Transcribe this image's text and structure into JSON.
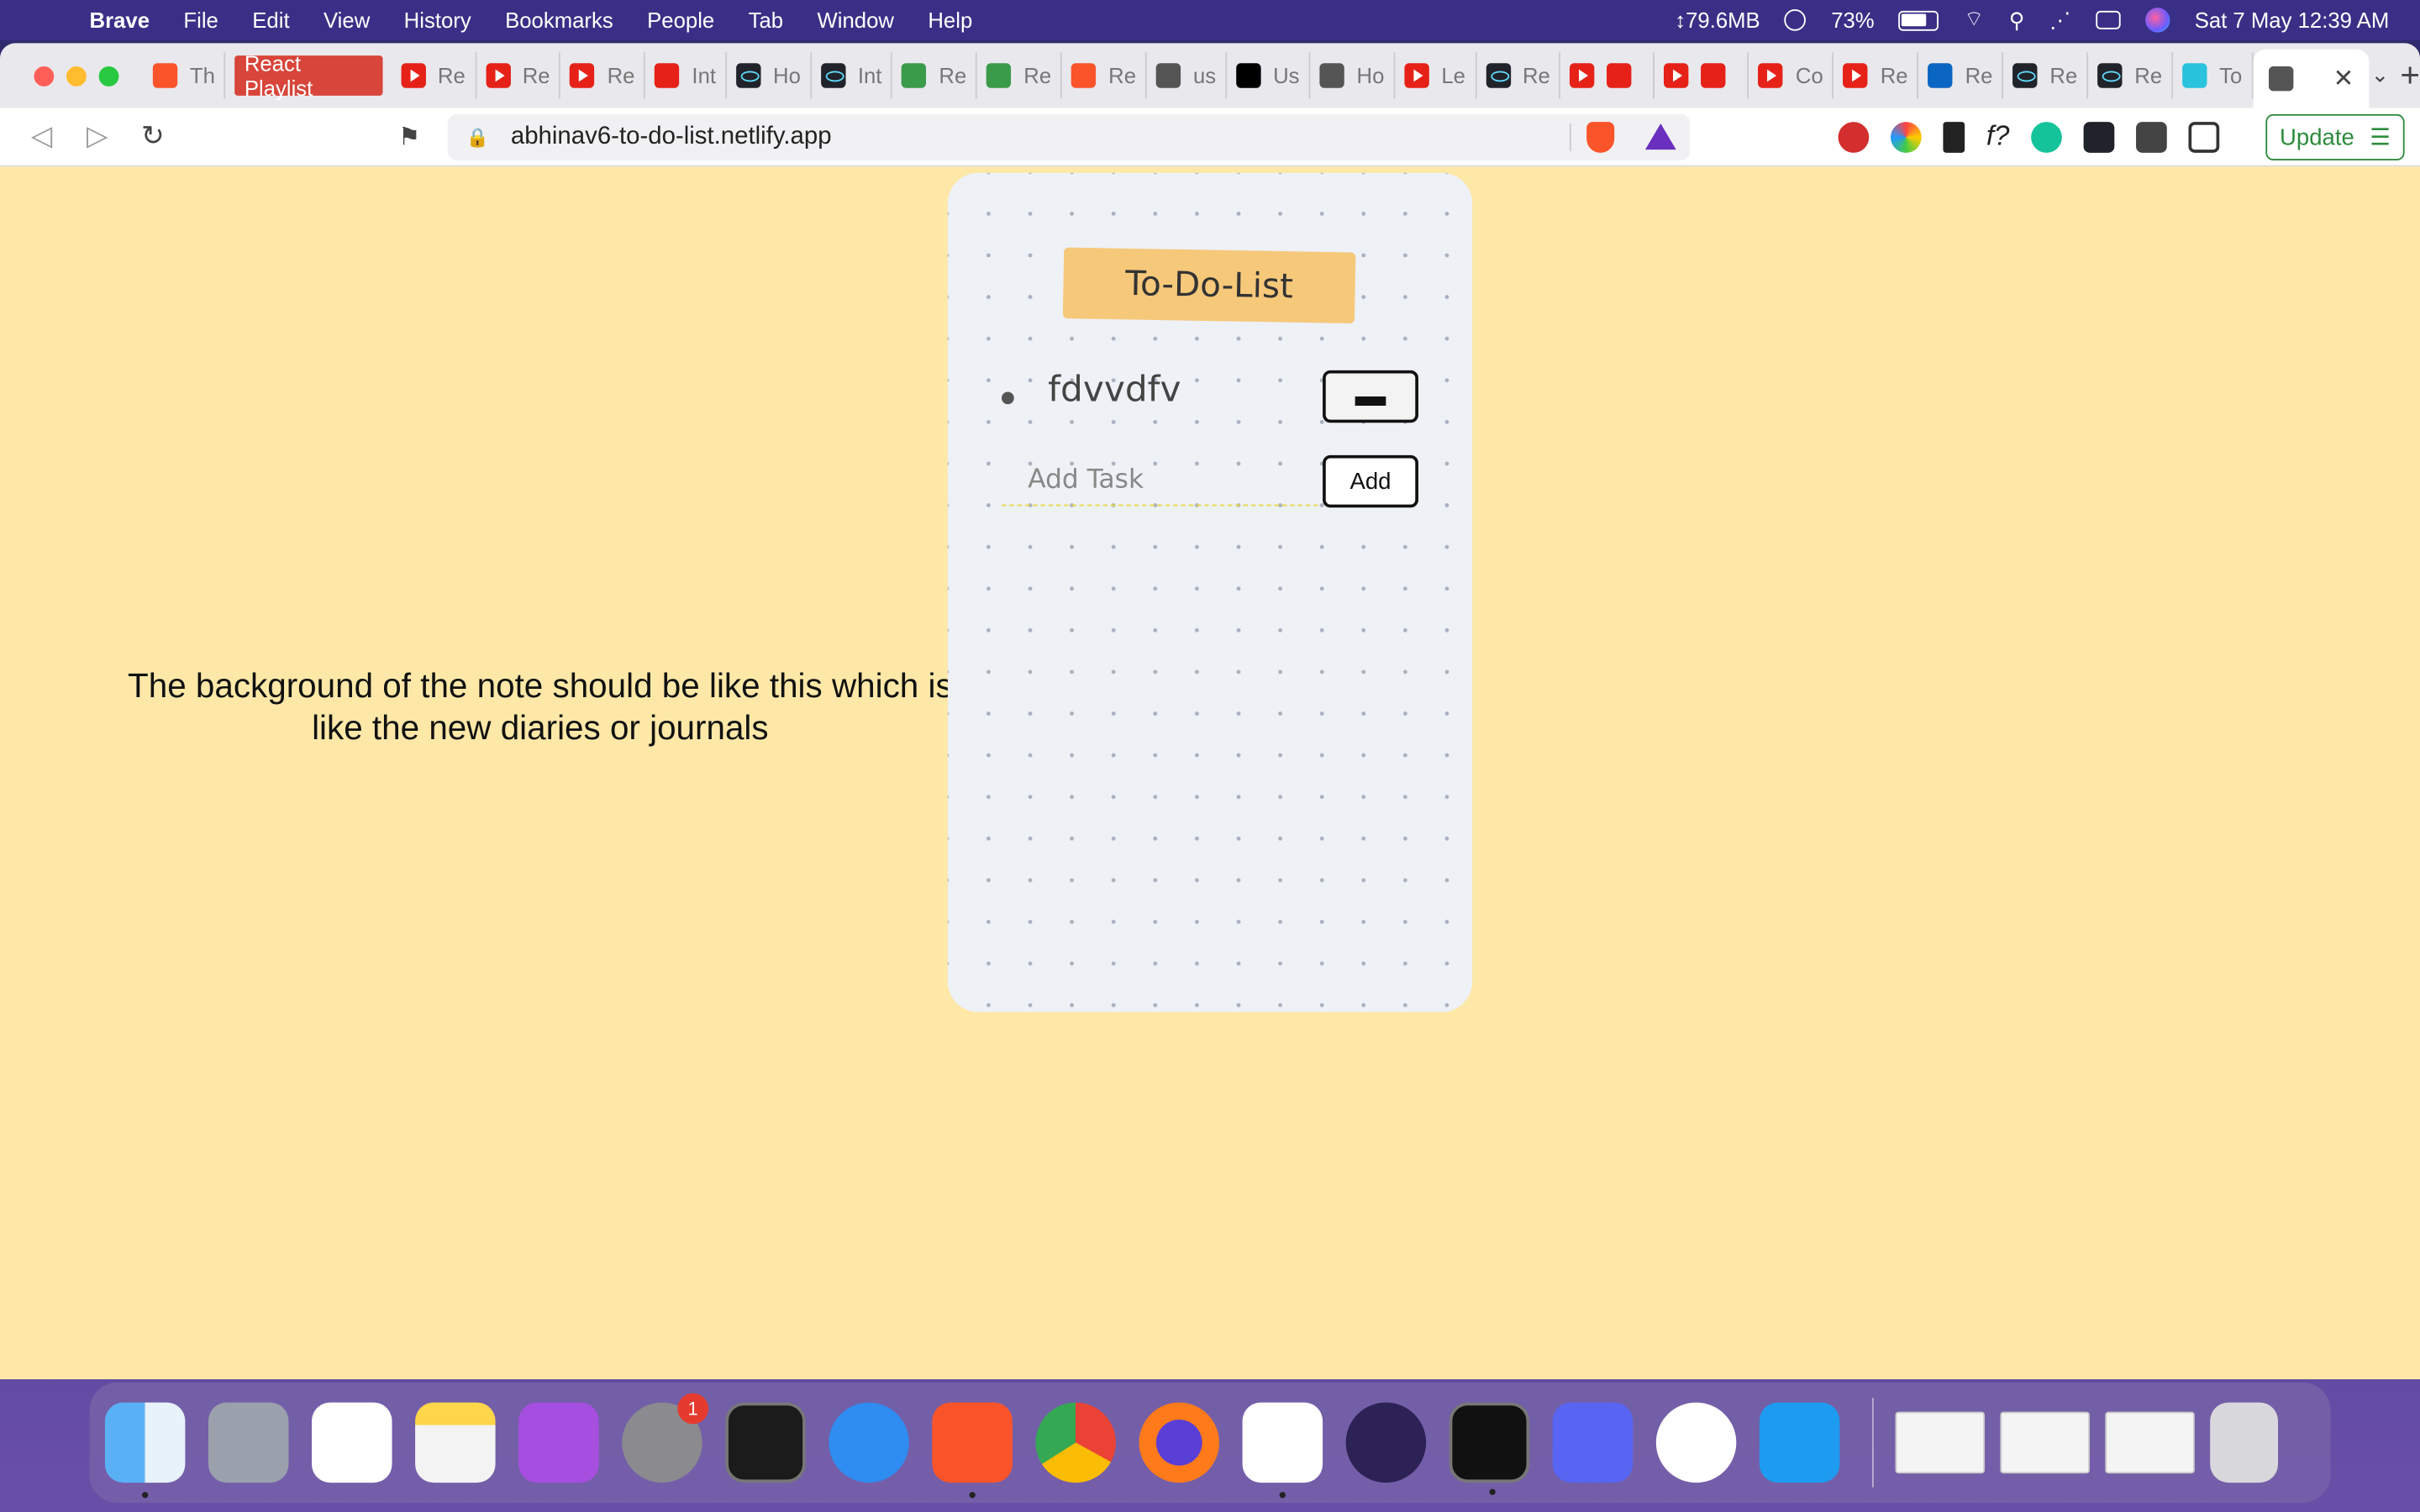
{
  "menubar": {
    "app": "Brave",
    "items": [
      "File",
      "Edit",
      "View",
      "History",
      "Bookmarks",
      "People",
      "Tab",
      "Window",
      "Help"
    ],
    "memory": "↕79.6MB",
    "battery": "73%",
    "datetime": "Sat 7 May  12:39 AM"
  },
  "tabs": {
    "items": [
      {
        "label": "Th",
        "icon": "avatar-icon"
      },
      {
        "label": "React Playlist",
        "icon": "bookmark-folder"
      },
      {
        "label": "Re",
        "icon": "youtube-icon"
      },
      {
        "label": "Re",
        "icon": "youtube-icon"
      },
      {
        "label": "Re",
        "icon": "youtube-icon"
      },
      {
        "label": "Int",
        "icon": "c-icon"
      },
      {
        "label": "Ho",
        "icon": "react-icon"
      },
      {
        "label": "Int",
        "icon": "react-icon"
      },
      {
        "label": "Re",
        "icon": "w3-icon"
      },
      {
        "label": "Re",
        "icon": "green-icon"
      },
      {
        "label": "Re",
        "icon": "brave-icon"
      },
      {
        "label": "us",
        "icon": "globe-icon"
      },
      {
        "label": "Us",
        "icon": "medium-icon"
      },
      {
        "label": "Ho",
        "icon": "globe-icon"
      },
      {
        "label": "Le",
        "icon": "youtube-icon"
      },
      {
        "label": "Re",
        "icon": "react-icon"
      },
      {
        "label": "",
        "icon": "youtube-icon"
      },
      {
        "label": "",
        "icon": "youtube-icon"
      },
      {
        "label": "Co",
        "icon": "youtube-icon"
      },
      {
        "label": "Re",
        "icon": "youtube-icon"
      },
      {
        "label": "Re",
        "icon": "r-icon"
      },
      {
        "label": "Re",
        "icon": "react-icon"
      },
      {
        "label": "Re",
        "icon": "react-icon"
      },
      {
        "label": "To",
        "icon": "netlify-icon"
      }
    ],
    "playlist_label": "React Playlist",
    "active_label": "",
    "new_tab": "+"
  },
  "toolbar": {
    "url": "abhinav6-to-do-list.netlify.app",
    "update_label": "Update"
  },
  "page": {
    "annotation": "The background of the note should be like this which is like the new diaries or journals",
    "title": "To-Do-List",
    "tasks": [
      {
        "text": "fdvvdfv",
        "remove_label": "▬"
      }
    ],
    "add_placeholder": "Add Task",
    "add_label": "Add"
  },
  "colors": {
    "page_bg": "#fde8a8",
    "card_bg": "#eef1f6",
    "title_tag": "#f6c87a",
    "update_green": "#2e8b3d"
  },
  "dock": {
    "apps": [
      "finder-icon",
      "launchpad-icon",
      "reminders-icon",
      "notes-icon",
      "podcasts-icon",
      "system-preferences-icon",
      "activity-monitor-icon",
      "safari-icon",
      "brave-icon",
      "chrome-icon",
      "firefox-icon",
      "vscode-icon",
      "eclipse-icon",
      "terminal-icon",
      "discord-icon",
      "instagram-icon",
      "twitter-icon"
    ],
    "settings_badge": "1"
  }
}
